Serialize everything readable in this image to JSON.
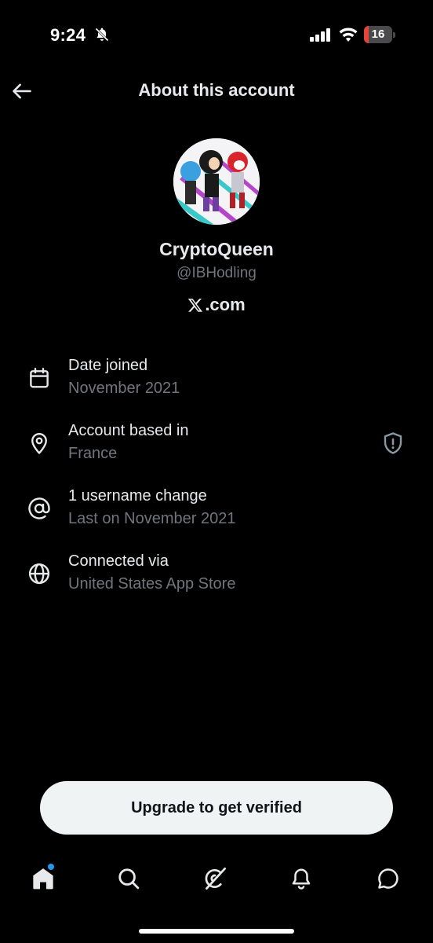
{
  "status_bar": {
    "time": "9:24",
    "battery_level": "16",
    "icons": [
      "bell-slash-icon",
      "signal-icon",
      "wifi-icon",
      "battery-icon"
    ]
  },
  "header": {
    "title": "About this account",
    "back_icon": "arrow-left-icon"
  },
  "profile": {
    "display_name": "CryptoQueen",
    "handle": "@IBHodling",
    "site": ".com",
    "site_logo": "x-logo-icon"
  },
  "info_items": [
    {
      "icon": "calendar-icon",
      "title": "Date joined",
      "subtitle": "November 2021"
    },
    {
      "icon": "location-pin-icon",
      "title": "Account based in",
      "subtitle": "France",
      "trailing_icon": "shield-icon"
    },
    {
      "icon": "at-sign-icon",
      "title": "1 username change",
      "subtitle": "Last on November 2021"
    },
    {
      "icon": "globe-icon",
      "title": "Connected via",
      "subtitle": "United States App Store"
    }
  ],
  "upgrade": {
    "label": "Upgrade to get verified"
  },
  "tab_bar": {
    "tabs": [
      "home-icon",
      "search-icon",
      "grok-icon",
      "bell-icon",
      "messages-icon"
    ],
    "accent": "#1d9bf0",
    "battery_color": "#e5443b"
  }
}
